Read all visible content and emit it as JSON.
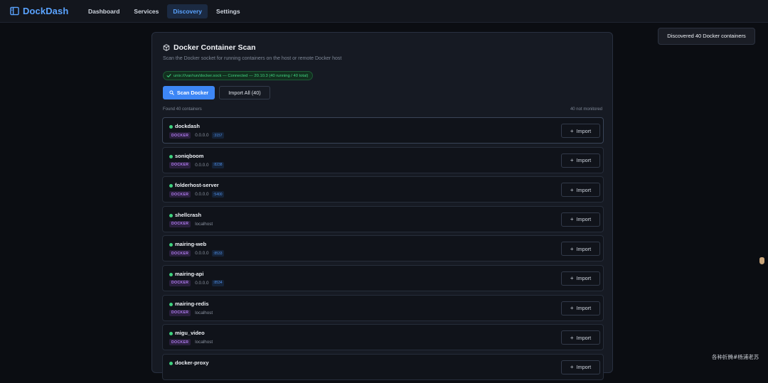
{
  "app": {
    "brand": "DockDash",
    "icon": "sidebar-panel-icon",
    "accent": "#5aa3ff"
  },
  "nav": [
    {
      "label": "Dashboard",
      "active": false
    },
    {
      "label": "Services",
      "active": false
    },
    {
      "label": "Discovery",
      "active": true
    },
    {
      "label": "Settings",
      "active": false
    }
  ],
  "toast": "Discovered 40 Docker containers",
  "card": {
    "title": "Docker Container Scan",
    "subtitle": "Scan the Docker socket for running containers on the host or remote Docker host",
    "status": "unix:///var/run/docker.sock — Connected — 20.10.3 (40 running / 40 total)",
    "scan_label": "Scan Docker",
    "import_all_label": "Import All (40)",
    "found": "Found 40 containers",
    "not_monitored": "40 not monitored",
    "import_label": "Import",
    "badge_color": "#b07bf0",
    "status_color": "#3fd27f"
  },
  "containers": [
    {
      "name": "dockdash",
      "type": "DOCKER",
      "host": "0.0.0.0",
      "port": ":3157"
    },
    {
      "name": "soniqboom",
      "type": "DOCKER",
      "host": "0.0.0.0",
      "port": ":8238"
    },
    {
      "name": "folderhost-server",
      "type": "DOCKER",
      "host": "0.0.0.0",
      "port": ":5400"
    },
    {
      "name": "shellcrash",
      "type": "DOCKER",
      "host": "localhost",
      "port": ""
    },
    {
      "name": "mairing-web",
      "type": "DOCKER",
      "host": "0.0.0.0",
      "port": ":8533"
    },
    {
      "name": "mairing-api",
      "type": "DOCKER",
      "host": "0.0.0.0",
      "port": ":8534"
    },
    {
      "name": "mairing-redis",
      "type": "DOCKER",
      "host": "localhost",
      "port": ""
    },
    {
      "name": "migu_video",
      "type": "DOCKER",
      "host": "localhost",
      "port": ""
    },
    {
      "name": "docker-proxy",
      "type": "DOCKER",
      "host": "",
      "port": ""
    }
  ],
  "watermark": "各种折腾#杨浦老苏"
}
